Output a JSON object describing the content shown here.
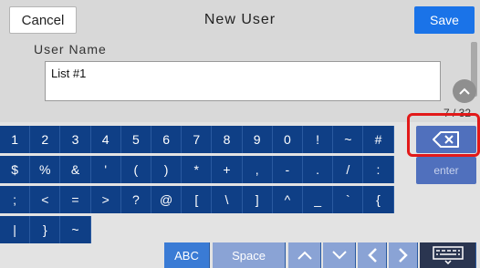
{
  "header": {
    "cancel_label": "Cancel",
    "title": "New User",
    "save_label": "Save"
  },
  "field": {
    "label": "User Name",
    "value": "List #1",
    "counter": "7 / 32"
  },
  "keyboard": {
    "rows": [
      [
        "1",
        "2",
        "3",
        "4",
        "5",
        "6",
        "7",
        "8",
        "9",
        "0",
        "!",
        "~",
        "#"
      ],
      [
        "$",
        "%",
        "&",
        "'",
        "(",
        ")",
        "*",
        "+",
        ",",
        "-",
        ".",
        "/",
        ":"
      ],
      [
        ";",
        "<",
        "=",
        ">",
        "?",
        "@",
        "[",
        "\\",
        "]",
        "^",
        "_",
        "`",
        "{"
      ],
      [
        "|",
        "}",
        "~"
      ]
    ],
    "enter_label": "enter",
    "abc_label": "ABC",
    "space_label": "Space"
  },
  "icons": {
    "backspace": "backspace-icon",
    "scroll_up": "chevron-up-icon",
    "up": "chevron-up-icon",
    "down": "chevron-down-icon",
    "left": "chevron-left-icon",
    "right": "chevron-right-icon",
    "keyboard": "keyboard-icon"
  },
  "colors": {
    "save": "#1a73e8",
    "key": "#0f3f86",
    "highlight": "#e21919"
  }
}
